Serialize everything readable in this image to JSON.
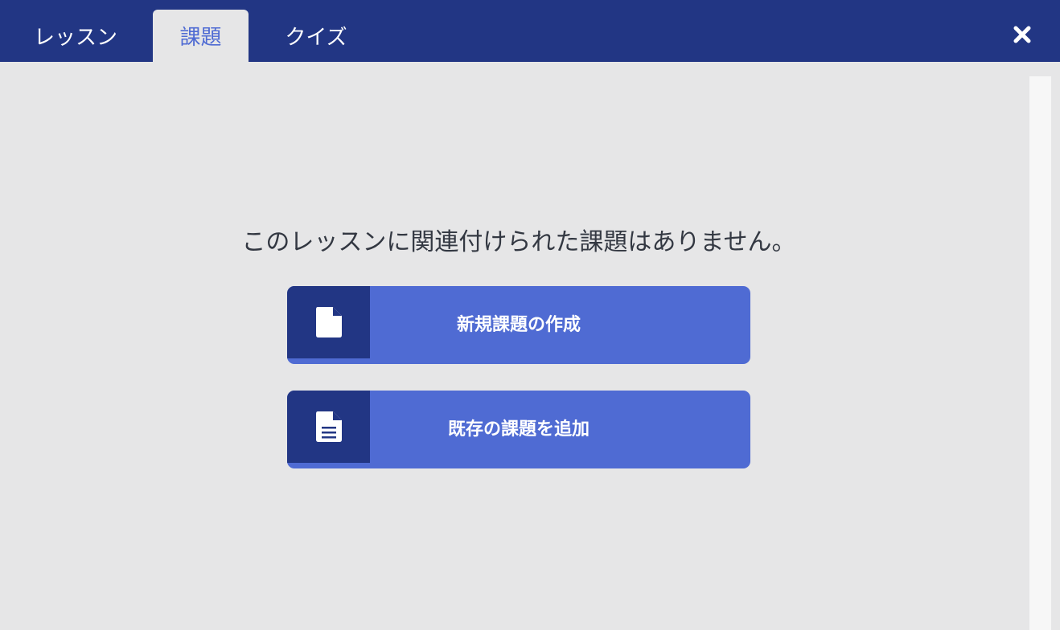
{
  "tabs": {
    "lessons": "レッスン",
    "assignments": "課題",
    "quiz": "クイズ"
  },
  "close_icon": "close-icon",
  "main": {
    "empty_message": "このレッスンに関連付けられた課題はありません。",
    "actions": {
      "create_new": {
        "label": "新規課題の作成",
        "icon": "file-icon"
      },
      "add_existing": {
        "label": "既存の課題を追加",
        "icon": "file-text-icon"
      }
    }
  },
  "colors": {
    "header": "#223684",
    "accent": "#4f6bd3",
    "background": "#e6e6e7"
  }
}
